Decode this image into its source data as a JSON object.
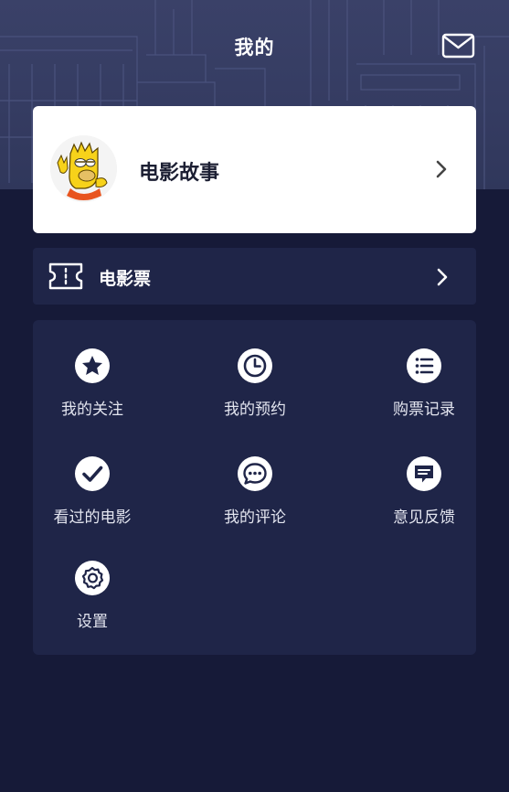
{
  "header": {
    "title": "我的",
    "mail_icon": "mail-icon"
  },
  "profile": {
    "name": "电影故事",
    "avatar_icon": "cartoon-avatar"
  },
  "ticket": {
    "label": "电影票",
    "icon": "ticket-icon"
  },
  "menu": [
    {
      "label": "我的关注",
      "icon": "star-icon"
    },
    {
      "label": "我的预约",
      "icon": "clock-icon"
    },
    {
      "label": "购票记录",
      "icon": "list-icon"
    },
    {
      "label": "看过的电影",
      "icon": "check-icon"
    },
    {
      "label": "我的评论",
      "icon": "comment-icon"
    },
    {
      "label": "意见反馈",
      "icon": "feedback-icon"
    },
    {
      "label": "设置",
      "icon": "gear-icon"
    }
  ],
  "colors": {
    "background": "#161a38",
    "panel": "#1f2548",
    "header": "#363d63",
    "card": "#ffffff",
    "icon_fill": "#1f2548"
  }
}
